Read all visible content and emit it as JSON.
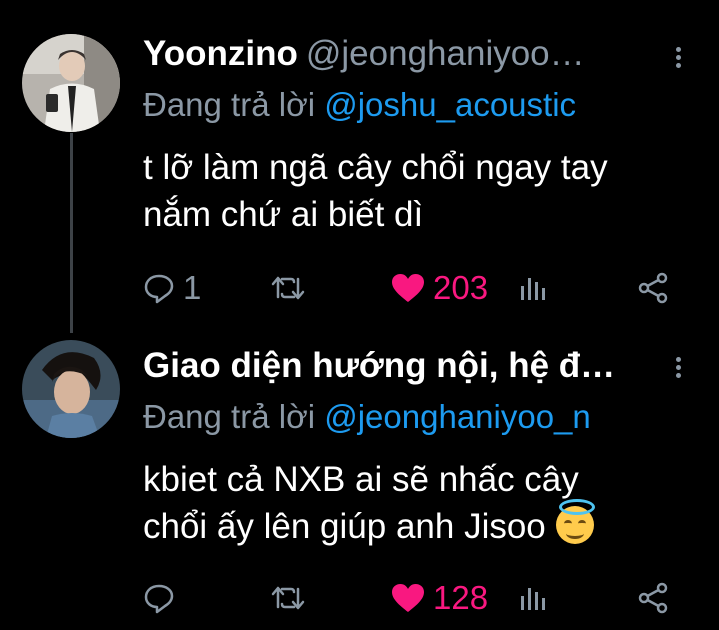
{
  "tweets": [
    {
      "name": "Yoonzino",
      "handle": "@jeonghaniyoo…",
      "replying_prefix": "Đang trả lời",
      "replying_to": "@joshu_acoustic",
      "text_line1": "t lỡ làm ngã cây chổi ngay tay",
      "text_line2": "nắm chứ ai biết dì",
      "reply_count": "1",
      "retweet_count": "",
      "like_count": "203"
    },
    {
      "name": "Giao diện hướng nội, hệ đ…",
      "handle": "",
      "replying_prefix": "Đang trả lời",
      "replying_to": "@jeonghaniyoo_n",
      "text_line1": "kbiet cả NXB ai sẽ nhấc cây",
      "text_line2": "chổi ấy lên giúp anh Jisoo",
      "emoji": "smiling-face-with-halo",
      "reply_count": "",
      "retweet_count": "",
      "like_count": "128"
    }
  ],
  "colors": {
    "background": "#000000",
    "text": "#ffffff",
    "secondary": "#8b98a5",
    "mention": "#1d9bf0",
    "like": "#f91880"
  }
}
